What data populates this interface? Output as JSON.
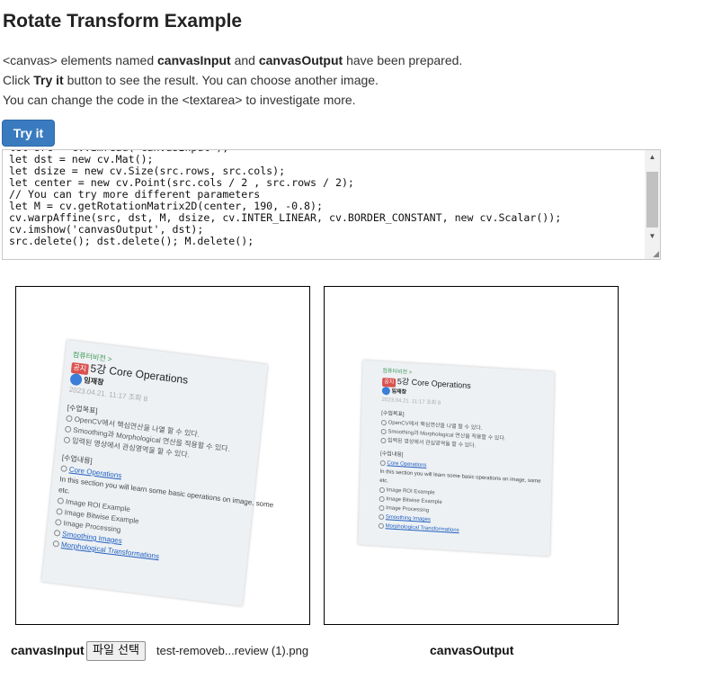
{
  "page": {
    "title": "Rotate Transform Example",
    "desc": {
      "line1_a": "<canvas> elements named ",
      "line1_b": "canvasInput",
      "line1_c": " and ",
      "line1_d": "canvasOutput",
      "line1_e": " have been prepared.",
      "line2_a": "Click ",
      "line2_b": "Try it",
      "line2_c": " button to see the result. You can choose another image.",
      "line3": "You can change the code in the <textarea> to investigate more."
    },
    "try_button": "Try it"
  },
  "code": {
    "lines": [
      "let src = cv.imread('canvasInput');",
      "let dst = new cv.Mat();",
      "let dsize = new cv.Size(src.rows, src.cols);",
      "let center = new cv.Point(src.cols / 2 , src.rows / 2);",
      "// You can try more different parameters",
      "let M = cv.getRotationMatrix2D(center, 190, -0.8);",
      "cv.warpAffine(src, dst, M, dsize, cv.INTER_LINEAR, cv.BORDER_CONSTANT, new cv.Scalar());",
      "cv.imshow('canvasOutput', dst);",
      "src.delete(); dst.delete(); M.delete();"
    ]
  },
  "doc": {
    "breadcrumb": "컴퓨터비전 >",
    "badge": "공지",
    "heading": "5강 Core Operations",
    "author": "임재창",
    "date": "2023.04.21. 11:17  조회 8",
    "goals_title": "[수업목표]",
    "goals": [
      "OpenCV에서 핵심연산을 나열 할 수 있다.",
      "Smoothing과 Morphological 연산을 적용할 수 있다.",
      "입력된 영상에서 관심영역을 할 수 있다."
    ],
    "content_title": "[수업내용]",
    "content_link": "Core Operations",
    "content_desc_1": "In this section you will learn some basic operations on image, some",
    "content_desc_2": "etc.",
    "items": [
      {
        "text": "Image ROI Example",
        "link": false
      },
      {
        "text": "Image Bitwise Example",
        "link": false
      },
      {
        "text": "Image Processing",
        "link": false
      },
      {
        "text": "Smoothing Images",
        "link": true
      },
      {
        "text": "Morphological Transformations",
        "link": true
      }
    ]
  },
  "bottom": {
    "input_label": "canvasInput",
    "file_button": "파일 선택",
    "file_name": "test-removeb...review (1).png",
    "output_label": "canvasOutput"
  }
}
